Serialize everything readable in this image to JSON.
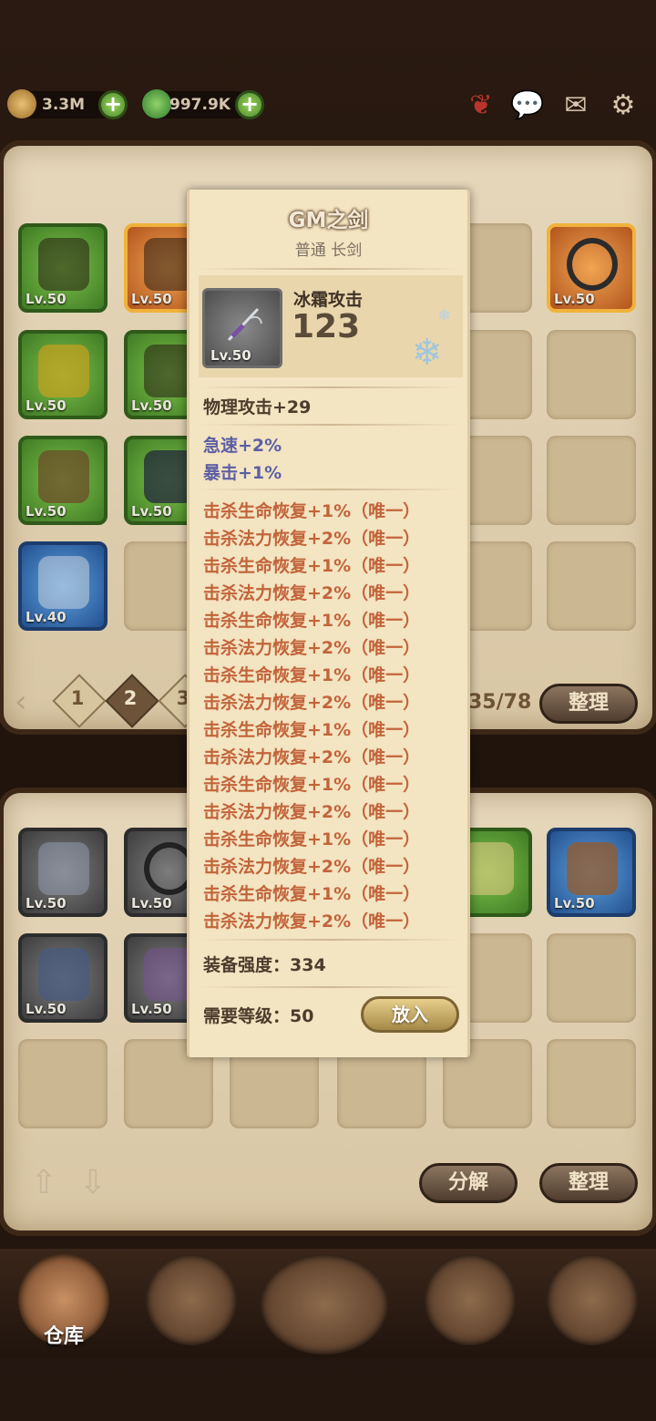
{
  "topbar": {
    "gold": "3.3M",
    "gems": "997.9K"
  },
  "bag": {
    "pages": [
      "1",
      "2",
      "3"
    ],
    "count": "35/78",
    "sort_label": "整理",
    "levels": {
      "row1": [
        "Lv.50",
        "Lv.50",
        "Lv.50"
      ],
      "row2": [
        "Lv.50",
        "Lv.50"
      ],
      "row3": [
        "Lv.50",
        "Lv.50"
      ],
      "row4": [
        "Lv.40"
      ]
    }
  },
  "stash": {
    "levels": [
      "Lv.50",
      "Lv.50",
      "50",
      "Lv.50",
      "Lv.50",
      "Lv.50"
    ],
    "decompose_label": "分解",
    "sort_label": "整理"
  },
  "nav": {
    "warehouse_label": "仓库"
  },
  "tooltip": {
    "name": "GM之剑",
    "subtitle": "普通 长剑",
    "icon_level": "Lv.50",
    "element_label": "冰霜攻击",
    "element_value": "123",
    "base_stat": "物理攻击+29",
    "blue_stats": [
      "急速+2%",
      "暴击+1%"
    ],
    "red_stats": [
      "击杀生命恢复+1%（唯一）",
      "击杀法力恢复+2%（唯一）",
      "击杀生命恢复+1%（唯一）",
      "击杀法力恢复+2%（唯一）",
      "击杀生命恢复+1%（唯一）",
      "击杀法力恢复+2%（唯一）",
      "击杀生命恢复+1%（唯一）",
      "击杀法力恢复+2%（唯一）",
      "击杀生命恢复+1%（唯一）",
      "击杀法力恢复+2%（唯一）",
      "击杀生命恢复+1%（唯一）",
      "击杀法力恢复+2%（唯一）",
      "击杀生命恢复+1%（唯一）",
      "击杀法力恢复+2%（唯一）",
      "击杀生命恢复+1%（唯一）",
      "击杀法力恢复+2%（唯一）"
    ],
    "strength": "装备强度：334",
    "required_level": "需要等级：50",
    "put_in_label": "放入"
  },
  "colors": {
    "parchment": "#f3e4c2",
    "blue_stat": "#5c5fa4",
    "red_stat": "#c2643a",
    "slot_green": "#3f7a24",
    "slot_blue": "#23508f",
    "slot_orange": "#f1b23b"
  }
}
